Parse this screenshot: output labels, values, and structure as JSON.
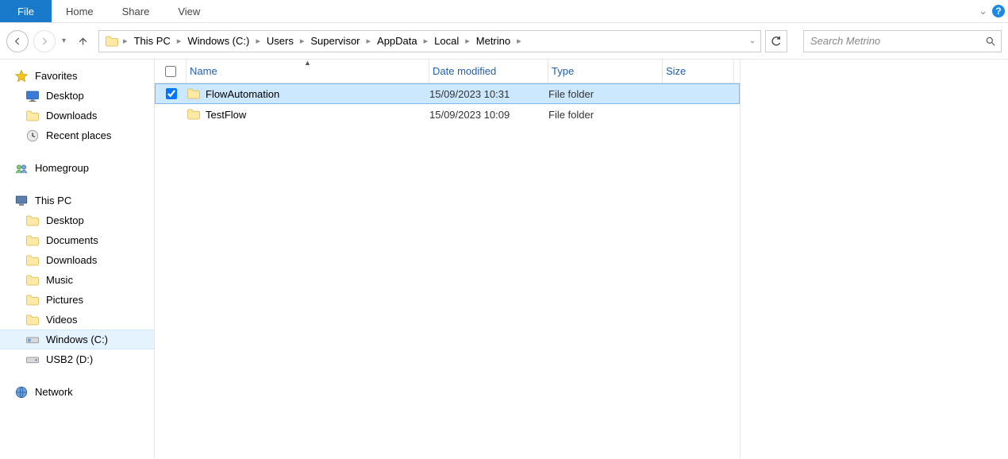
{
  "menu": {
    "file": "File",
    "items": [
      "Home",
      "Share",
      "View"
    ]
  },
  "breadcrumbs": [
    "This PC",
    "Windows (C:)",
    "Users",
    "Supervisor",
    "AppData",
    "Local",
    "Metrino"
  ],
  "search": {
    "placeholder": "Search Metrino"
  },
  "sidebar": {
    "favorites": {
      "label": "Favorites",
      "items": [
        "Desktop",
        "Downloads",
        "Recent places"
      ]
    },
    "homegroup": {
      "label": "Homegroup"
    },
    "thispc": {
      "label": "This PC",
      "items": [
        "Desktop",
        "Documents",
        "Downloads",
        "Music",
        "Pictures",
        "Videos",
        "Windows (C:)",
        "USB2 (D:)"
      ]
    },
    "network": {
      "label": "Network"
    }
  },
  "columns": {
    "name": "Name",
    "date": "Date modified",
    "type": "Type",
    "size": "Size"
  },
  "rows": [
    {
      "checked": true,
      "name": "FlowAutomation",
      "date": "15/09/2023 10:31",
      "type": "File folder",
      "size": ""
    },
    {
      "checked": false,
      "name": "TestFlow",
      "date": "15/09/2023 10:09",
      "type": "File folder",
      "size": ""
    }
  ]
}
